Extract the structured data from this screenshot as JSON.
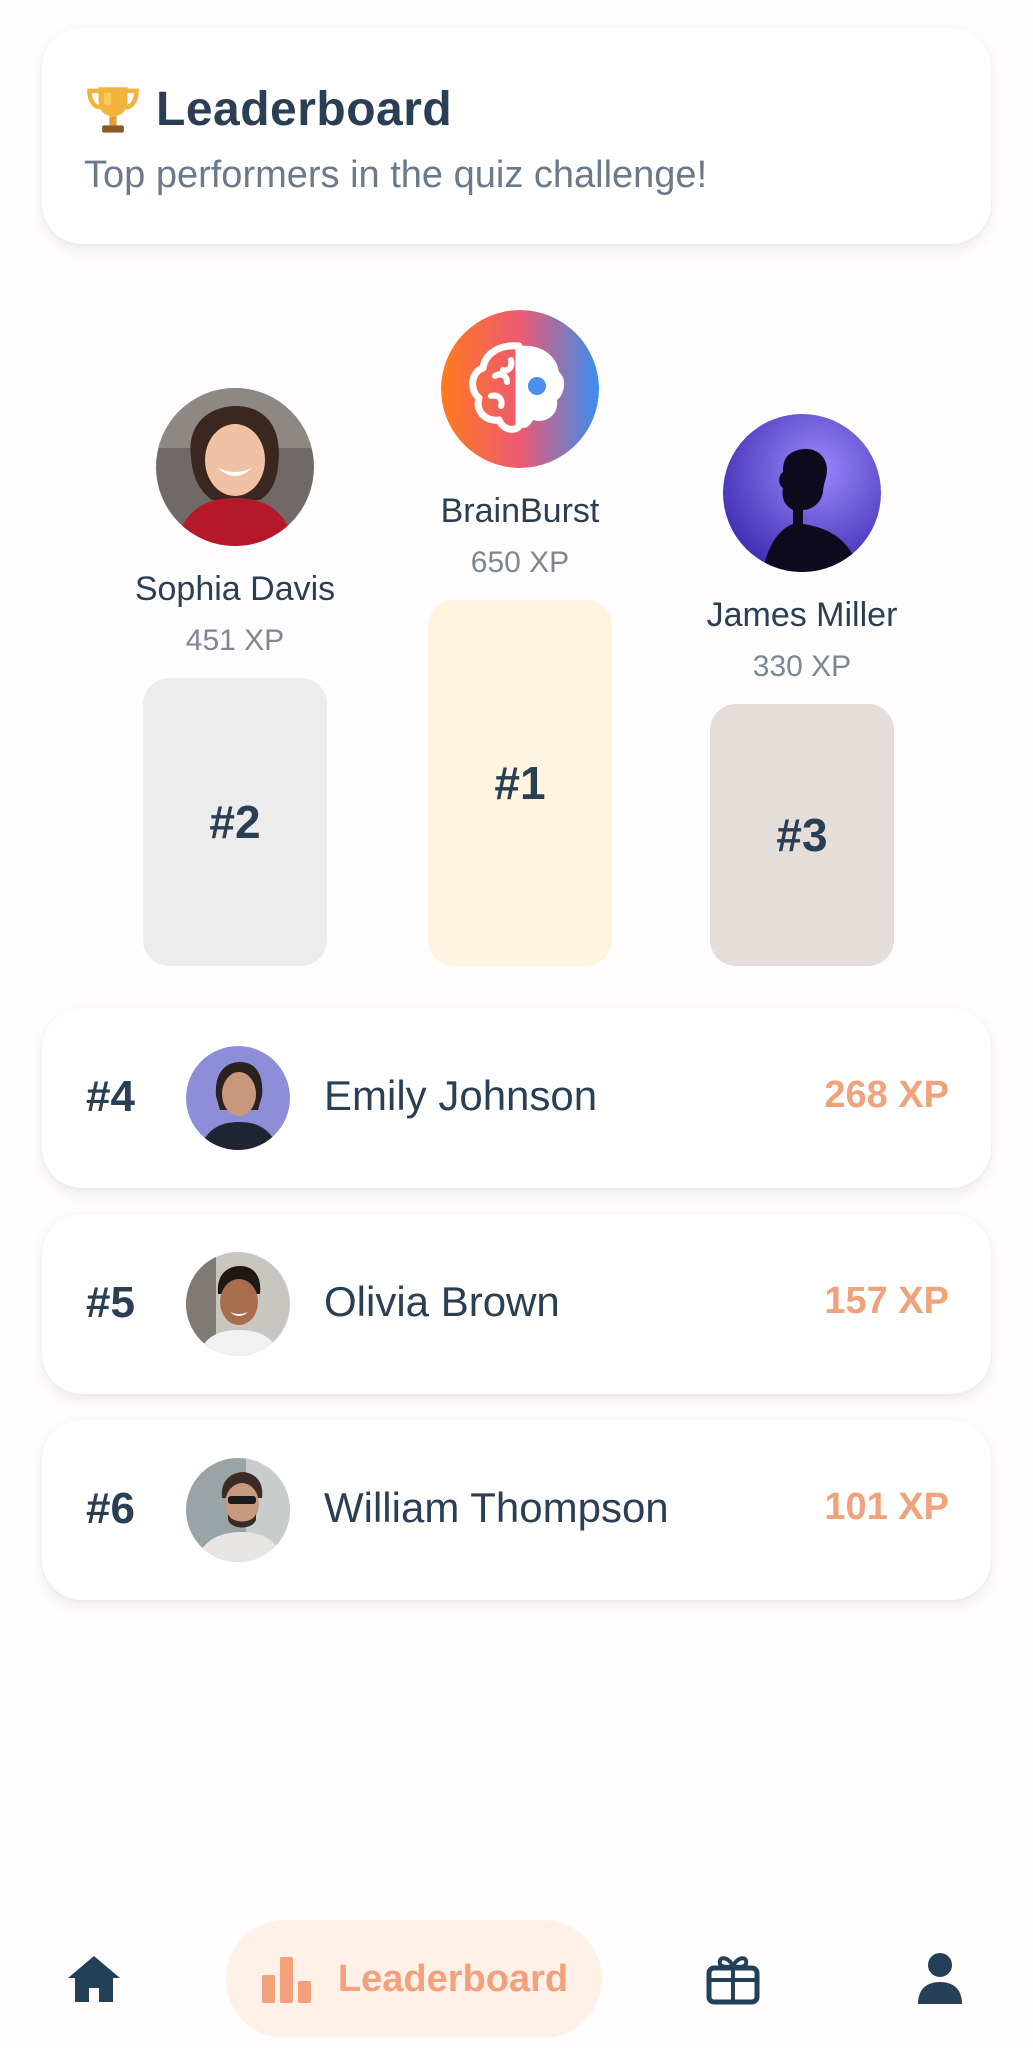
{
  "header": {
    "title": "Leaderboard",
    "subtitle": "Top performers in the quiz challenge!",
    "icon": "trophy-icon"
  },
  "podium": [
    {
      "rank_label": "#2",
      "name": "Sophia Davis",
      "xp": "451 XP",
      "color": "#ececec"
    },
    {
      "rank_label": "#1",
      "name": "BrainBurst",
      "xp": "650 XP",
      "color": "#fff4e0"
    },
    {
      "rank_label": "#3",
      "name": "James Miller",
      "xp": "330 XP",
      "color": "#e5ddd9"
    }
  ],
  "list": [
    {
      "rank_label": "#4",
      "name": "Emily Johnson",
      "xp": "268 XP"
    },
    {
      "rank_label": "#5",
      "name": "Olivia Brown",
      "xp": "157 XP"
    },
    {
      "rank_label": "#6",
      "name": "William Thompson",
      "xp": "101 XP"
    }
  ],
  "nav": {
    "items": [
      {
        "icon": "home-icon"
      },
      {
        "icon": "bar-chart-icon",
        "label": "Leaderboard",
        "active": true
      },
      {
        "icon": "gift-icon"
      },
      {
        "icon": "profile-icon"
      }
    ]
  },
  "colors": {
    "accent": "#f3a07c",
    "text": "#2a3f54",
    "muted": "#7b8794"
  }
}
